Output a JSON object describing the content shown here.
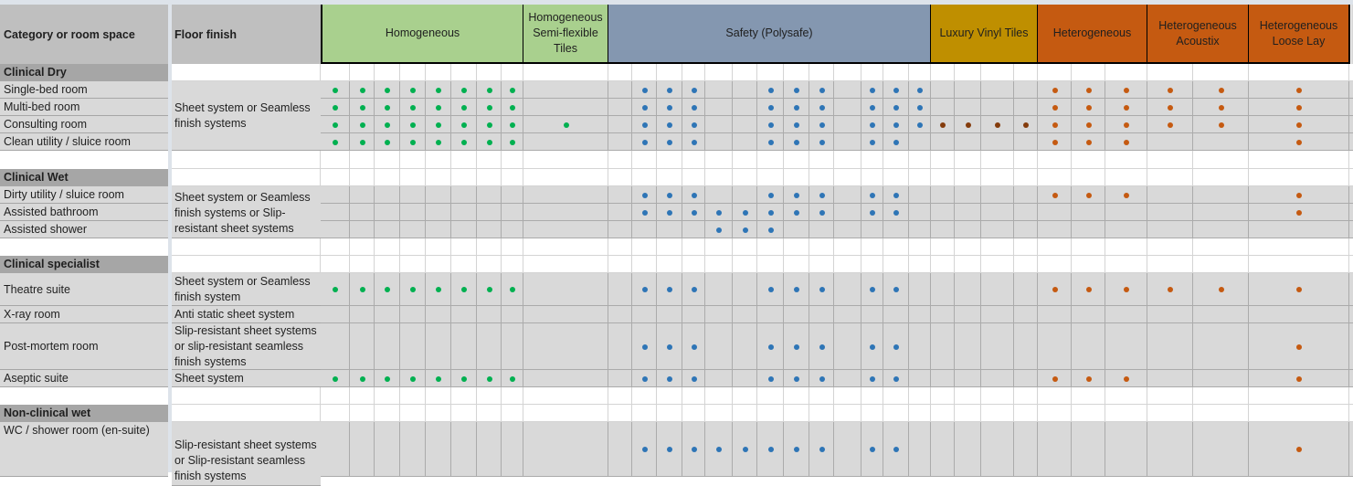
{
  "headers": {
    "category": "Category or room space",
    "finish": "Floor finish"
  },
  "groups": [
    {
      "label": "Homogeneous",
      "color": "#a9d08e",
      "cols": 8,
      "dot": "#00b050"
    },
    {
      "label": "Homogeneous Semi-flexible Tiles",
      "color": "#a9d08e",
      "cols": 1,
      "dot": "#00b050"
    },
    {
      "label": "Safety (Polysafe)",
      "color": "#8497b0",
      "cols": 13,
      "dot": "#2e75b6"
    },
    {
      "label": "Luxury Vinyl Tiles",
      "color": "#bf8f00",
      "cols": 4,
      "dot": "#843c0c"
    },
    {
      "label": "Heterogeneous",
      "color": "#c55a11",
      "cols": 3,
      "dot": "#c55a11"
    },
    {
      "label": "Heterogeneous Acoustix",
      "color": "#c55a11",
      "cols": 2,
      "dot": "#c55a11"
    },
    {
      "label": "Heterogeneous Loose Lay",
      "color": "#c55a11",
      "cols": 1,
      "dot": "#c55a11"
    }
  ],
  "sections": [
    {
      "category": "Clinical Dry",
      "finish": "Sheet system or Seamless finish systems",
      "rooms": [
        {
          "name": "Single-bed room",
          "marks": {
            "homogeneous": [
              0,
              1,
              2,
              3,
              4,
              5,
              6,
              7
            ],
            "semiflex": [],
            "safety": [
              1,
              2,
              3,
              6,
              7,
              8,
              10,
              11,
              12
            ],
            "lvt": [],
            "hetero": [
              0,
              1,
              2
            ],
            "acoustix": [
              0,
              1
            ],
            "looselay": [
              0
            ]
          }
        },
        {
          "name": "Multi-bed room",
          "marks": {
            "homogeneous": [
              0,
              1,
              2,
              3,
              4,
              5,
              6,
              7
            ],
            "semiflex": [],
            "safety": [
              1,
              2,
              3,
              6,
              7,
              8,
              10,
              11,
              12
            ],
            "lvt": [],
            "hetero": [
              0,
              1,
              2
            ],
            "acoustix": [
              0,
              1
            ],
            "looselay": [
              0
            ]
          }
        },
        {
          "name": "Consulting room",
          "marks": {
            "homogeneous": [
              0,
              1,
              2,
              3,
              4,
              5,
              6,
              7
            ],
            "semiflex": [
              0
            ],
            "safety": [
              1,
              2,
              3,
              6,
              7,
              8,
              10,
              11,
              12
            ],
            "lvt": [
              0,
              1,
              2,
              3
            ],
            "hetero": [
              0,
              1,
              2
            ],
            "acoustix": [
              0,
              1
            ],
            "looselay": [
              0
            ]
          }
        },
        {
          "name": "Clean utility / sluice room",
          "marks": {
            "homogeneous": [
              0,
              1,
              2,
              3,
              4,
              5,
              6,
              7
            ],
            "semiflex": [],
            "safety": [
              1,
              2,
              3,
              6,
              7,
              8,
              10,
              11
            ],
            "lvt": [],
            "hetero": [
              0,
              1,
              2
            ],
            "acoustix": [],
            "looselay": [
              0
            ]
          }
        }
      ]
    },
    {
      "category": "Clinical Wet",
      "finish": "Sheet system or Seamless finish systems or Slip-resistant sheet systems",
      "rooms": [
        {
          "name": "Dirty utility / sluice room",
          "marks": {
            "homogeneous": [],
            "semiflex": [],
            "safety": [
              1,
              2,
              3,
              6,
              7,
              8,
              10,
              11
            ],
            "lvt": [],
            "hetero": [
              0,
              1,
              2
            ],
            "acoustix": [],
            "looselay": [
              0
            ]
          }
        },
        {
          "name": "Assisted bathroom",
          "marks": {
            "homogeneous": [],
            "semiflex": [],
            "safety": [
              1,
              2,
              3,
              4,
              5,
              6,
              7,
              8,
              10,
              11
            ],
            "lvt": [],
            "hetero": [],
            "acoustix": [],
            "looselay": [
              0
            ]
          }
        },
        {
          "name": "Assisted shower",
          "marks": {
            "homogeneous": [],
            "semiflex": [],
            "safety": [
              4,
              5,
              6
            ],
            "lvt": [],
            "hetero": [],
            "acoustix": [],
            "looselay": []
          }
        }
      ]
    },
    {
      "category": "Clinical specialist",
      "rooms": [
        {
          "name": "Theatre suite",
          "finish": "Sheet system or Seamless finish system",
          "marks": {
            "homogeneous": [
              0,
              1,
              2,
              3,
              4,
              5,
              6,
              7
            ],
            "semiflex": [],
            "safety": [
              1,
              2,
              3,
              6,
              7,
              8,
              10,
              11
            ],
            "lvt": [],
            "hetero": [
              0,
              1,
              2
            ],
            "acoustix": [
              0,
              1
            ],
            "looselay": [
              0
            ]
          }
        },
        {
          "name": "X-ray room",
          "finish": "Anti static sheet system",
          "marks": {
            "homogeneous": [],
            "semiflex": [],
            "safety": [],
            "lvt": [],
            "hetero": [],
            "acoustix": [],
            "looselay": []
          }
        },
        {
          "name": "Post-mortem room",
          "finish": "Slip-resistant sheet systems or slip-resistant seamless finish systems",
          "marks": {
            "homogeneous": [],
            "semiflex": [],
            "safety": [
              1,
              2,
              3,
              6,
              7,
              8,
              10,
              11
            ],
            "lvt": [],
            "hetero": [],
            "acoustix": [],
            "looselay": [
              0
            ]
          }
        },
        {
          "name": "Aseptic suite",
          "finish": "Sheet system",
          "marks": {
            "homogeneous": [
              0,
              1,
              2,
              3,
              4,
              5,
              6,
              7
            ],
            "semiflex": [],
            "safety": [
              1,
              2,
              3,
              6,
              7,
              8,
              10,
              11
            ],
            "lvt": [],
            "hetero": [
              0,
              1,
              2
            ],
            "acoustix": [],
            "looselay": [
              0
            ]
          }
        }
      ]
    },
    {
      "category": "Non-clinical wet",
      "finish": "Slip-resistant sheet systems or Slip-resistant seamless finish systems",
      "rooms": [
        {
          "name": "WC / shower room (en-suite)",
          "marks": {
            "homogeneous": [],
            "semiflex": [],
            "safety": [
              1,
              2,
              3,
              4,
              5,
              6,
              7,
              8,
              10,
              11
            ],
            "lvt": [],
            "hetero": [],
            "acoustix": [],
            "looselay": [
              0
            ]
          }
        }
      ]
    }
  ]
}
